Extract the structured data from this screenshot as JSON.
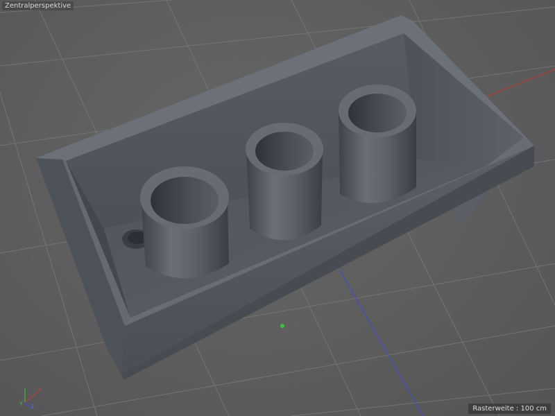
{
  "viewport": {
    "projection_label": "Zentralperspektive",
    "grid_spacing_label": "Rasterweite",
    "grid_spacing_separator": " : ",
    "grid_spacing_value": "100 cm"
  },
  "axes": {
    "x_label": "X",
    "y_label": "Y",
    "z_label": "Z",
    "x_color": "#d23a3a",
    "y_color": "#3fbf3f",
    "z_color": "#3f4fe0"
  },
  "colors": {
    "background": "#5f5f5f",
    "grid_line": "#777777",
    "object_face": "#5a5f67",
    "object_top": "#6b7079",
    "object_dark": "#41464d"
  }
}
